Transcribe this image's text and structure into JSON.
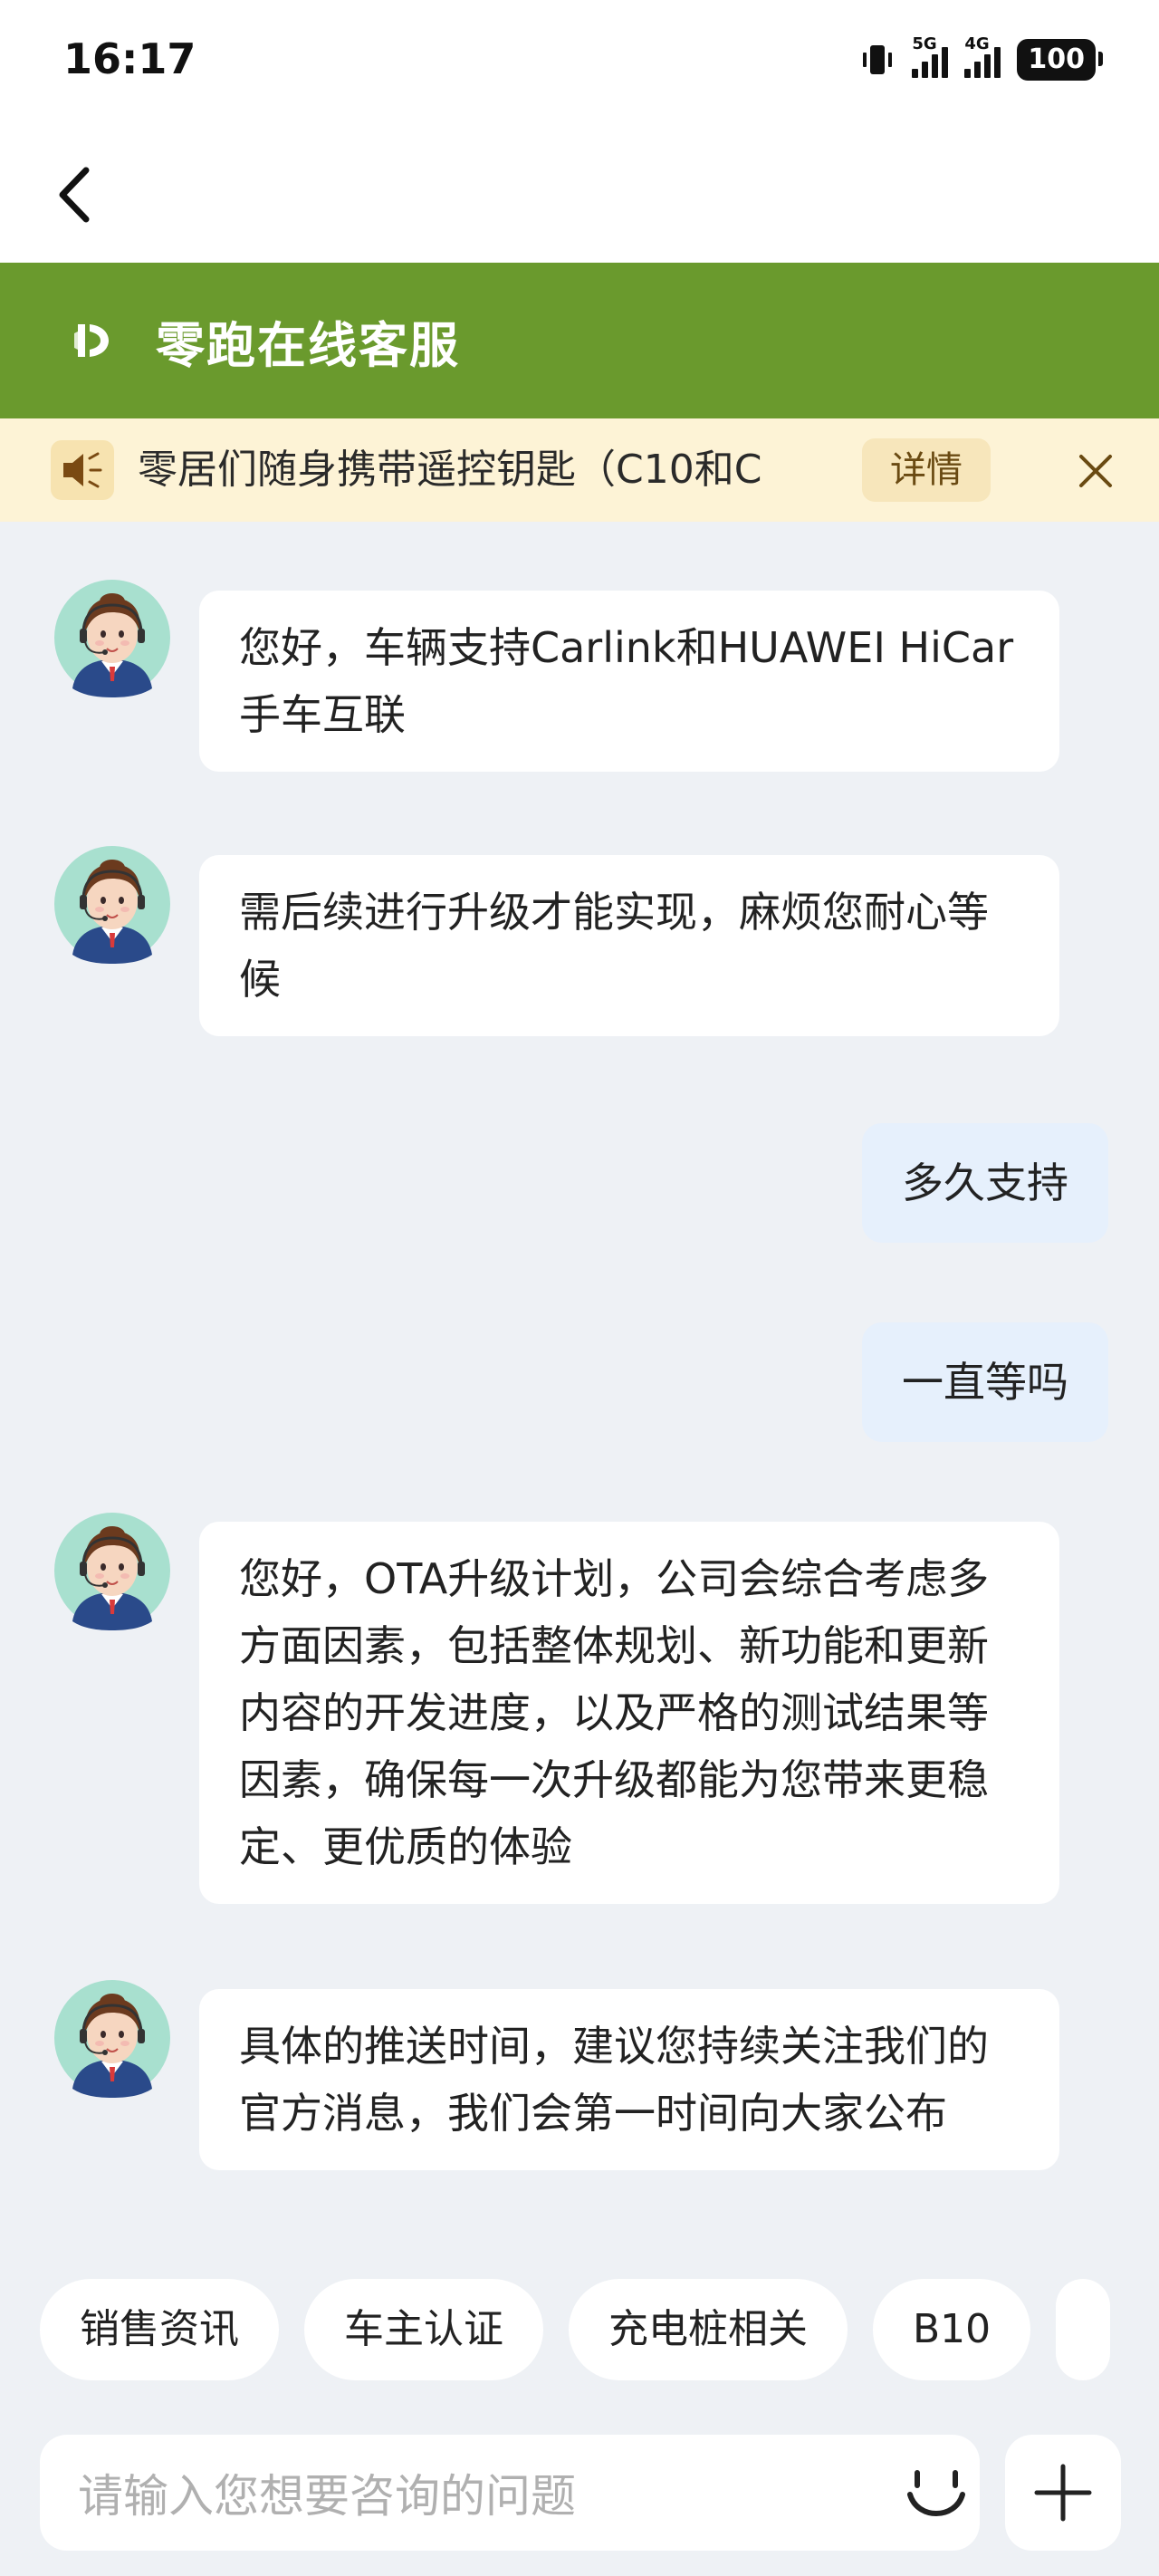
{
  "status_bar": {
    "time": "16:17",
    "network_1": "5G",
    "network_2": "4G",
    "battery": "100"
  },
  "header": {
    "title": "零跑在线客服",
    "brand_color": "#6a9a2d"
  },
  "notice": {
    "text": "零居们随身携带遥控钥匙（C10和C",
    "detail_label": "详情"
  },
  "messages": [
    {
      "role": "agent",
      "text": "您好，车辆支持Carlink和HUAWEI HiCar手车互联"
    },
    {
      "role": "agent",
      "text": "需后续进行升级才能实现，麻烦您耐心等候"
    },
    {
      "role": "user",
      "text": "多久支持"
    },
    {
      "role": "user",
      "text": "一直等吗"
    },
    {
      "role": "agent",
      "text": "您好，OTA升级计划，公司会综合考虑多方面因素，包括整体规划、新功能和更新内容的开发进度，以及严格的测试结果等因素，确保每一次升级都能为您带来更稳定、更优质的体验"
    },
    {
      "role": "agent",
      "text": "具体的推送时间，建议您持续关注我们的官方消息，我们会第一时间向大家公布"
    }
  ],
  "quick_replies": [
    "销售资讯",
    "车主认证",
    "充电桩相关",
    "B10"
  ],
  "input": {
    "placeholder": "请输入您想要咨询的问题"
  },
  "icons": {
    "back": "back-arrow-icon",
    "speaker": "speaker-icon",
    "close": "close-icon",
    "emoji": "smile-icon",
    "plus": "plus-icon"
  }
}
